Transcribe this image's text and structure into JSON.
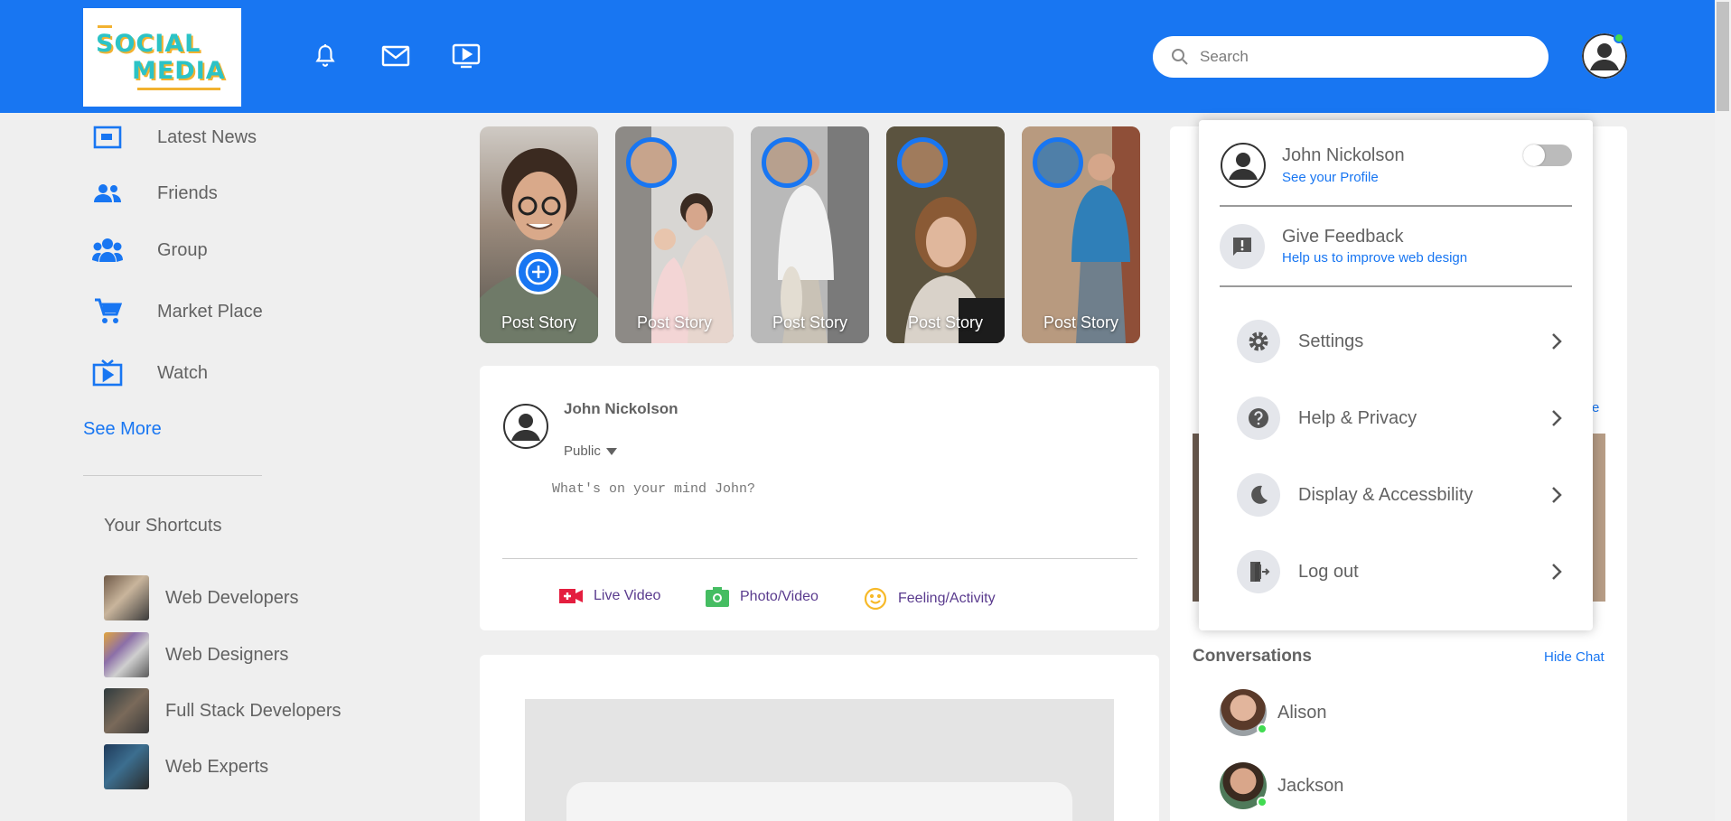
{
  "header": {
    "logo_line1": "SOCIAL",
    "logo_line2": "MEDIA",
    "search_placeholder": "Search",
    "icons": [
      "bell-icon",
      "mail-icon",
      "video-icon"
    ]
  },
  "sidebar": {
    "links": [
      {
        "label": "Latest News",
        "icon": "news-icon"
      },
      {
        "label": "Friends",
        "icon": "friends-icon"
      },
      {
        "label": "Group",
        "icon": "group-icon"
      },
      {
        "label": "Market Place",
        "icon": "cart-icon"
      },
      {
        "label": "Watch",
        "icon": "watch-icon"
      }
    ],
    "see_more": "See More",
    "shortcuts_title": "Your Shortcuts",
    "shortcuts": [
      {
        "label": "Web Developers"
      },
      {
        "label": "Web Designers"
      },
      {
        "label": "Full Stack Developers"
      },
      {
        "label": "Web Experts"
      }
    ]
  },
  "stories": [
    {
      "label": "Post Story"
    },
    {
      "label": "Post Story"
    },
    {
      "label": "Post Story"
    },
    {
      "label": "Post Story"
    },
    {
      "label": "Post Story"
    }
  ],
  "composer": {
    "user_name": "John Nickolson",
    "privacy": "Public",
    "placeholder": "What's on your mind John?",
    "actions": [
      {
        "label": "Live Video",
        "icon": "live-video-icon",
        "color": "#e41e3f"
      },
      {
        "label": "Photo/Video",
        "icon": "camera-icon",
        "color": "#45bd62"
      },
      {
        "label": "Feeling/Activity",
        "icon": "smile-icon",
        "color": "#f7b928"
      }
    ]
  },
  "right": {
    "peek_link": "e",
    "conversations_title": "Conversations",
    "hide_chat": "Hide Chat",
    "contacts": [
      {
        "name": "Alison"
      },
      {
        "name": "Jackson"
      }
    ]
  },
  "dropdown": {
    "profile_name": "John Nickolson",
    "profile_sub": "See your Profile",
    "feedback_title": "Give Feedback",
    "feedback_sub": "Help us to improve web design",
    "items": [
      {
        "label": "Settings",
        "icon": "gear-icon"
      },
      {
        "label": "Help & Privacy",
        "icon": "help-icon"
      },
      {
        "label": "Display & Accessbility",
        "icon": "moon-icon"
      },
      {
        "label": "Log out",
        "icon": "logout-icon"
      }
    ]
  },
  "colors": {
    "brand_blue": "#1876f2",
    "online_green": "#41db51",
    "text_gray": "#626262"
  }
}
